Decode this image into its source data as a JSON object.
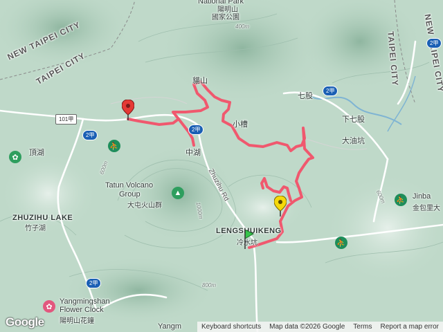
{
  "map": {
    "labels": {
      "new_taipei_left": "NEW TAIPEI CITY",
      "taipei_left": "TAIPEI CITY",
      "taipei_right": "TAIPEI CITY",
      "new_taipei_right": "NEW TAIPEI CITY",
      "national_park_en": "National Park",
      "national_park_zh1": "陽明山",
      "national_park_zh2": "國家公園",
      "peak_zh": "貓山",
      "qigu": "七股",
      "xia_qigu": "下七股",
      "dayoukeng": "大油坑",
      "dinghu": "頂湖",
      "zhonghu": "中湖",
      "xiaocao": "小槽",
      "tatun_en1": "Tatun Volcano",
      "tatun_en2": "Group",
      "tatun_zh": "大屯火山群",
      "zhuzihu_en": "ZHUZIHU LAKE",
      "zhuzihu_zh": "竹子湖",
      "lengshuikeng_en": "LENGSHUIKENG",
      "lengshuikeng_zh": "冷水坑",
      "flowerclock_en1": "Yangmingshan",
      "flowerclock_en2": "Flower Clock",
      "flowerclock_zh": "陽明山花鐘",
      "jinbao_en": "Jinba",
      "jinbao_zh": "金包里大",
      "zhuzi_rd": "Zhuzihu Rd",
      "yangm_bottom": "Yangm",
      "elev_400": "400m",
      "elev_600": "600m",
      "elev_800": "800m",
      "elev_1000": "1000m",
      "elev_600_right": "600m"
    },
    "shields": {
      "r101a": "101甲",
      "r2a_1": "2甲",
      "r2a_2": "2甲",
      "r2a_3": "2甲",
      "r2a_4": "2甲",
      "r2a_5": "2甲"
    },
    "colors": {
      "terrain": "#bfd9c9",
      "route": "#f0586e",
      "road": "#ffffff",
      "start_marker": "#e53935",
      "end_marker": "#f5d90a",
      "green_marker": "#35c44a",
      "water": "#a9cde0"
    },
    "icons": {
      "start_marker": "red-pin-icon",
      "end_marker": "yellow-pin-icon",
      "green_marker": "green-flag-icon"
    },
    "attribution": {
      "logo": "Google",
      "shortcuts": "Keyboard shortcuts",
      "data": "Map data ©2026 Google",
      "terms": "Terms",
      "report": "Report a map error"
    }
  }
}
